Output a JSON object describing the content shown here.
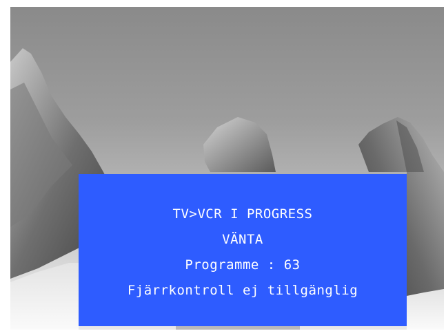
{
  "osd": {
    "line1": "TV>VCR I PROGRESS",
    "line2": "VÄNTA",
    "line3": "Programme : 63",
    "line4": "Fjärrkontroll ej tillgänglig",
    "background_color": "#2e5cff",
    "text_color": "#ffffff"
  },
  "background": {
    "description_icon": "mountain-landscape-image"
  }
}
